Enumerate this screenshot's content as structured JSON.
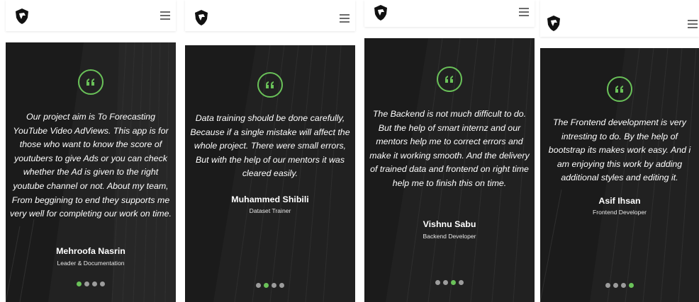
{
  "theme": {
    "accent": "#6ac259",
    "dark_bg": "#2b2b2b"
  },
  "icons": {
    "logo": "shield-logo-icon",
    "menu": "hamburger-menu-icon",
    "quote": "quote-icon"
  },
  "screens": [
    {
      "quote": "Our project aim is To Forecasting YouTube Video AdViews. This app is for those who want to know the score of youtubers to give Ads or you can check whether the Ad is given to the right youtube channel or not. About my team, From beggining to end they supports me very well for completing our work on time.",
      "name": "Mehroofa Nasrin",
      "role": "Leader & Documentation",
      "active_dot": 0
    },
    {
      "quote": "Data training should be done carefully, Because if a single mistake will affect the whole project. There were small errors, But with the help of our mentors it was cleared easily.",
      "name": "Muhammed Shibili",
      "role": "Dataset Trainer",
      "active_dot": 1
    },
    {
      "quote": "The Backend is not much difficult to do. But the help of smart internz and our mentors help me to correct errors and make it working smooth. And the delivery of trained data and frontend on right time help me to finish this on time.",
      "name": "Vishnu Sabu",
      "role": "Backend Developer",
      "active_dot": 2
    },
    {
      "quote": "The Frontend development is very intresting to do. By the help of bootstrap its makes work easy. And i am enjoying this work by adding additional styles and editing it.",
      "name": "Asif Ihsan",
      "role": "Frontend Developer",
      "active_dot": 3
    }
  ]
}
